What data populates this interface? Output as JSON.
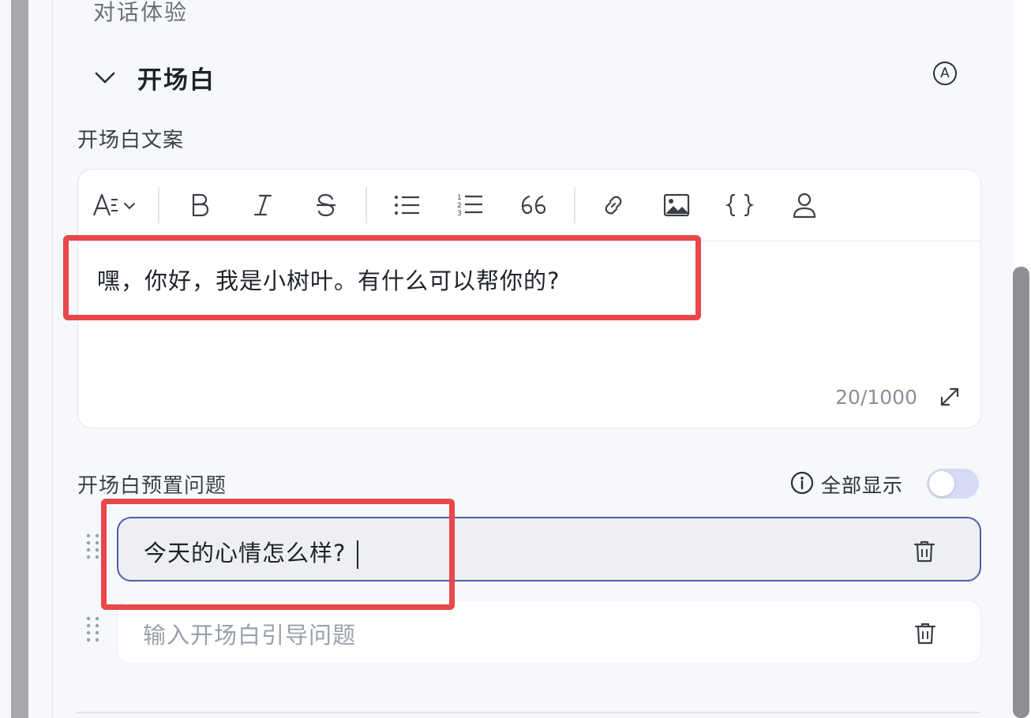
{
  "section": {
    "title": "对话体验"
  },
  "opening": {
    "title": "开场白",
    "a_icon_letter": "A",
    "copy_label": "开场白文案",
    "toolbar": {
      "items": [
        "text-style-icon",
        "bold-icon",
        "italic-icon",
        "strikethrough-icon",
        "bullet-list-icon",
        "numbered-list-icon",
        "quote-icon",
        "link-icon",
        "image-icon",
        "code-braces-icon",
        "user-variable-icon"
      ]
    },
    "editor_text": "嘿，你好，我是小树叶。有什么可以帮你的?",
    "counter": "20/1000"
  },
  "preset": {
    "label": "开场白预置问题",
    "show_all_label": "全部显示",
    "show_all_enabled": false,
    "questions": [
      {
        "value": "今天的心情怎么样?",
        "placeholder": ""
      },
      {
        "value": "",
        "placeholder": "输入开场白引导问题"
      }
    ]
  },
  "colors": {
    "accent": "#4b5fa6",
    "annotation_red": "#e8484a",
    "toggle_off": "#d6dbf5"
  }
}
